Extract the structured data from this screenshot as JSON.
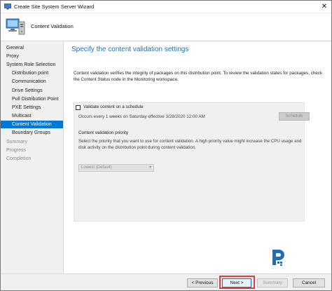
{
  "window": {
    "title": "Create Site System Server Wizard",
    "close_glyph": "✕"
  },
  "header": {
    "title": "Content Validation"
  },
  "sidebar": {
    "items": [
      {
        "label": "General",
        "level": "top",
        "state": "normal"
      },
      {
        "label": "Proxy",
        "level": "top",
        "state": "normal"
      },
      {
        "label": "System Role Selection",
        "level": "top",
        "state": "normal"
      },
      {
        "label": "Distribution point",
        "level": "sub",
        "state": "normal"
      },
      {
        "label": "Communication",
        "level": "sub",
        "state": "normal"
      },
      {
        "label": "Drive Settings",
        "level": "sub",
        "state": "normal"
      },
      {
        "label": "Pull Distribution Point",
        "level": "sub",
        "state": "normal"
      },
      {
        "label": "PXE Settings",
        "level": "sub",
        "state": "normal"
      },
      {
        "label": "Multicast",
        "level": "sub",
        "state": "normal"
      },
      {
        "label": "Content Validation",
        "level": "sub",
        "state": "active"
      },
      {
        "label": "Boundary Groups",
        "level": "sub",
        "state": "normal"
      },
      {
        "label": "Summary",
        "level": "top",
        "state": "muted"
      },
      {
        "label": "Progress",
        "level": "top",
        "state": "muted"
      },
      {
        "label": "Completion",
        "level": "top",
        "state": "muted"
      }
    ]
  },
  "main": {
    "title": "Specify the content validation settings",
    "description": "Content validation verifies the integrity of packages on this distribution point. To review the validation states for packages, check the Content Status node in the Monitoring workspace.",
    "validate_checkbox": {
      "label": "Validate content on a schedule",
      "checked": false
    },
    "schedule_text": "Occurs every 1 weeks on Saturday effective 3/28/2020 12:00 AM",
    "schedule_button": "Schedule",
    "priority_heading": "Content validation priority",
    "priority_description": "Select the priority that you want to use for content validation. A high priority value might increase the CPU usage and disk activity on the distribution point during content validation.",
    "priority_select": {
      "value": "Lowest (Default)"
    }
  },
  "footer": {
    "previous": "< Previous",
    "next": "Next >",
    "summary": "Summary",
    "cancel": "Cancel"
  },
  "colors": {
    "accent": "#0078d7",
    "title_blue": "#1e73be",
    "highlight_red": "#e33a3a",
    "logo_blue": "#1e6fb8"
  },
  "icons": {
    "window": "computer-icon",
    "header": "computer-server-icon",
    "logo": "brand-logo-icon"
  }
}
